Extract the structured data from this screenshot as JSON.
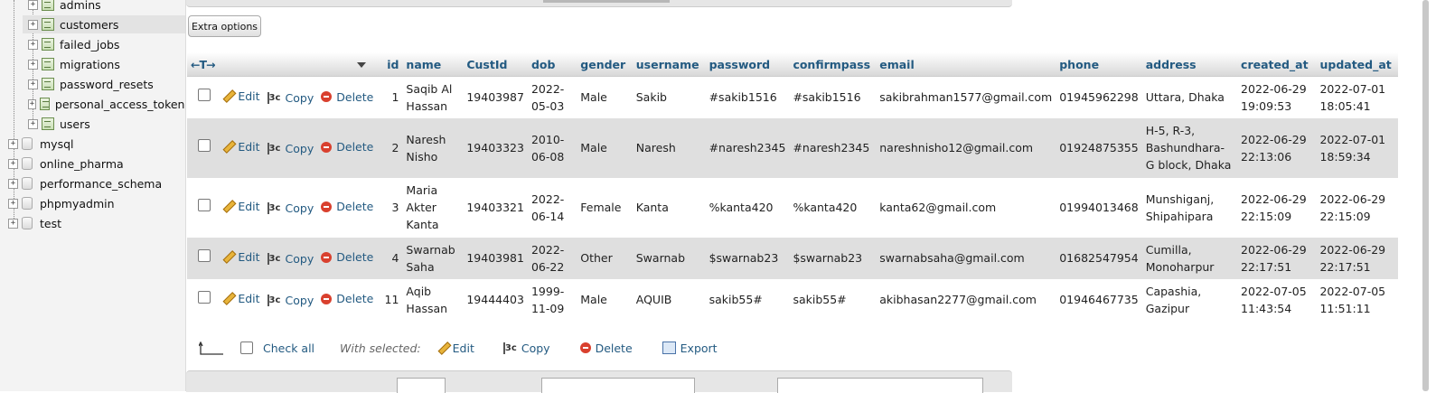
{
  "navigation": {
    "tables": [
      "admins",
      "customers",
      "failed_jobs",
      "migrations",
      "password_resets",
      "personal_access_tokens",
      "users"
    ],
    "active_table": "customers",
    "databases": [
      "mysql",
      "online_pharma",
      "performance_schema",
      "phpmyadmin",
      "test"
    ]
  },
  "toolbar": {
    "extra_options_label": "Extra options"
  },
  "table": {
    "sort_arrows": "←T→",
    "columns": [
      "id",
      "name",
      "CustId",
      "dob",
      "gender",
      "username",
      "password",
      "confirmpass",
      "email",
      "phone",
      "address",
      "created_at",
      "updated_at"
    ],
    "actions": {
      "edit": "Edit",
      "copy": "Copy",
      "delete": "Delete"
    },
    "rows": [
      {
        "id": "1",
        "name": "Saqib Al Hassan",
        "CustId": "19403987",
        "dob": "2022-05-03",
        "gender": "Male",
        "username": "Sakib",
        "password": "#sakib1516",
        "confirmpass": "#sakib1516",
        "email": "sakibrahman1577@gmail.com",
        "phone": "01945962298",
        "address": "Uttara, Dhaka",
        "created_at": "2022-06-29 19:09:53",
        "updated_at": "2022-07-01 18:05:41"
      },
      {
        "id": "2",
        "name": "Naresh Nisho",
        "CustId": "19403323",
        "dob": "2010-06-08",
        "gender": "Male",
        "username": "Naresh",
        "password": "#naresh2345",
        "confirmpass": "#naresh2345",
        "email": "nareshnisho12@gmail.com",
        "phone": "01924875355",
        "address": "H-5, R-3, Bashundhara-G block, Dhaka",
        "created_at": "2022-06-29 22:13:06",
        "updated_at": "2022-07-01 18:59:34"
      },
      {
        "id": "3",
        "name": "Maria Akter Kanta",
        "CustId": "19403321",
        "dob": "2022-06-14",
        "gender": "Female",
        "username": "Kanta",
        "password": "%kanta420",
        "confirmpass": "%kanta420",
        "email": "kanta62@gmail.com",
        "phone": "01994013468",
        "address": "Munshiganj, Shipahipara",
        "created_at": "2022-06-29 22:15:09",
        "updated_at": "2022-06-29 22:15:09"
      },
      {
        "id": "4",
        "name": "Swarnab Saha",
        "CustId": "19403981",
        "dob": "2022-06-22",
        "gender": "Other",
        "username": "Swarnab",
        "password": "$swarnab23",
        "confirmpass": "$swarnab23",
        "email": "swarnabsaha@gmail.com",
        "phone": "01682547954",
        "address": "Cumilla, Monoharpur",
        "created_at": "2022-06-29 22:17:51",
        "updated_at": "2022-06-29 22:17:51"
      },
      {
        "id": "11",
        "name": "Aqib Hassan",
        "CustId": "19444403",
        "dob": "1999-11-09",
        "gender": "Male",
        "username": "AQUIB",
        "password": "sakib55#",
        "confirmpass": "sakib55#",
        "email": "akibhasan2277@gmail.com",
        "phone": "01946467735",
        "address": "Capashia, Gazipur",
        "created_at": "2022-07-05 11:43:54",
        "updated_at": "2022-07-05 11:51:11"
      }
    ]
  },
  "bulk": {
    "check_all": "Check all",
    "with_selected": "With selected:",
    "edit": "Edit",
    "copy": "Copy",
    "delete": "Delete",
    "export": "Export"
  },
  "colors": {
    "link": "#235a81",
    "row_alt": "#dfdfdf",
    "delete": "#d9402e"
  }
}
